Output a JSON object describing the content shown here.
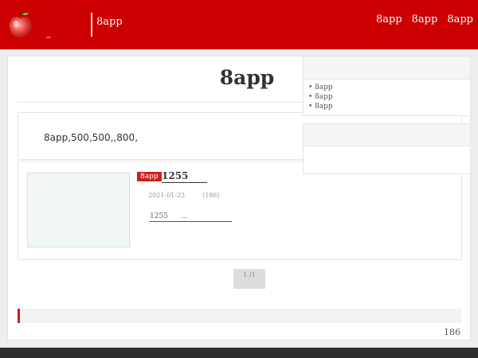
{
  "header": {
    "brand": "8app",
    "nav": [
      "8app",
      "8app",
      "8app"
    ],
    "accent": "#cc0000",
    "logo_icon": "apple-icon"
  },
  "main": {
    "title": "8app",
    "intro": "8app,500,500,,800,"
  },
  "post": {
    "tag": "8app",
    "title": "1255",
    "date": "2021-01-23",
    "views": "(186)",
    "excerpt_start": "1255",
    "excerpt_end": "..."
  },
  "pagination": {
    "label": "1 /1"
  },
  "sidebar": {
    "items": [
      "8app",
      "8app",
      "8app"
    ]
  },
  "stats": {
    "count": "186"
  }
}
